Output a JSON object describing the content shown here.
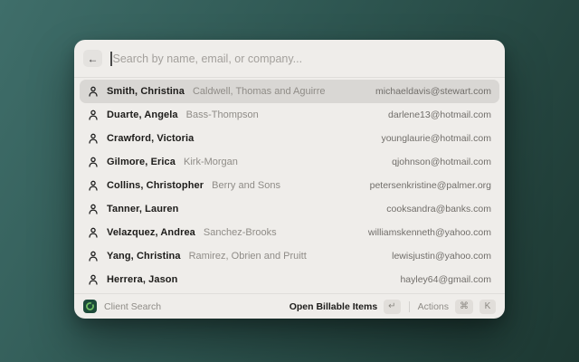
{
  "search": {
    "placeholder": "Search by name, email, or company..."
  },
  "results": [
    {
      "name": "Smith, Christina",
      "company": "Caldwell, Thomas and Aguirre",
      "email": "michaeldavis@stewart.com",
      "selected": true
    },
    {
      "name": "Duarte, Angela",
      "company": "Bass-Thompson",
      "email": "darlene13@hotmail.com",
      "selected": false
    },
    {
      "name": "Crawford, Victoria",
      "company": "",
      "email": "younglaurie@hotmail.com",
      "selected": false
    },
    {
      "name": "Gilmore, Erica",
      "company": "Kirk-Morgan",
      "email": "qjohnson@hotmail.com",
      "selected": false
    },
    {
      "name": "Collins, Christopher",
      "company": "Berry and Sons",
      "email": "petersenkristine@palmer.org",
      "selected": false
    },
    {
      "name": "Tanner, Lauren",
      "company": "",
      "email": "cooksandra@banks.com",
      "selected": false
    },
    {
      "name": "Velazquez, Andrea",
      "company": "Sanchez-Brooks",
      "email": "williamskenneth@yahoo.com",
      "selected": false
    },
    {
      "name": "Yang, Christina",
      "company": "Ramirez, Obrien and Pruitt",
      "email": "lewisjustin@yahoo.com",
      "selected": false
    },
    {
      "name": "Herrera, Jason",
      "company": "",
      "email": "hayley64@gmail.com",
      "selected": false
    }
  ],
  "footer": {
    "app_label": "Client Search",
    "primary_action": "Open Billable Items",
    "primary_key": "↵",
    "secondary_action": "Actions",
    "secondary_keys": [
      "⌘",
      "K"
    ]
  },
  "icons": {
    "back": "arrow-left-icon",
    "result": "person-icon",
    "app": "client-search-app-icon"
  },
  "colors": {
    "background_top_left": "#3f6e6a",
    "background_bottom_right": "#1d3832",
    "panel": "#efedea",
    "selected_row": "#d9d7d4",
    "app_icon_bg": "#1d4a3a",
    "app_icon_glyph": "#6fbe63",
    "name_text": "#1d1c1a",
    "muted_text": "#8f8c87",
    "email_text": "#716e6a"
  }
}
